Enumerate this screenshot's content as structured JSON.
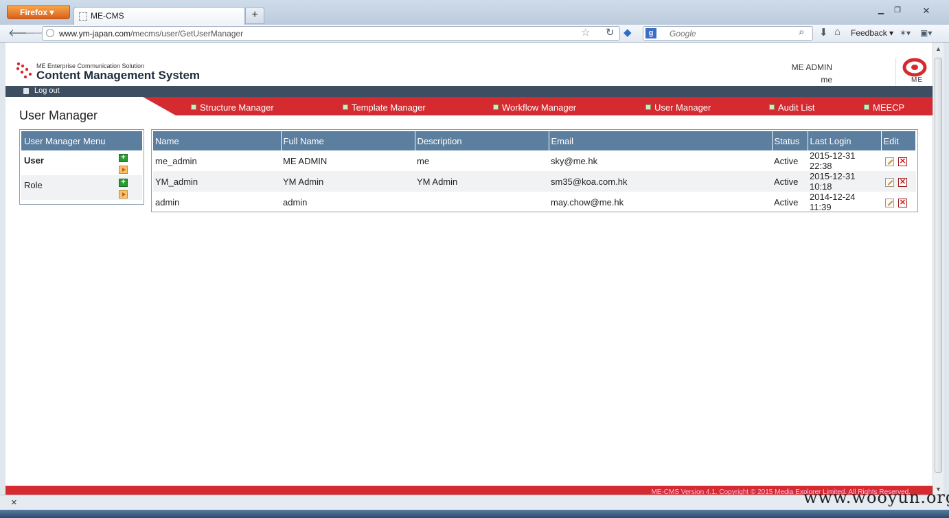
{
  "browser": {
    "app_button": "Firefox",
    "tab_title": "ME-CMS",
    "new_tab": "+",
    "url_host": "www.ym-japan.com",
    "url_path": "/mecms/user/GetUserManager",
    "search_placeholder": "Google",
    "feedback_label": "Feedback",
    "icons": [
      "back-arrow-icon",
      "forward-arrow-icon",
      "bookmark-star-icon",
      "reload-icon",
      "download-icon",
      "home-icon"
    ]
  },
  "header": {
    "subtitle": "ME Enterprise Communication Solution",
    "title": "Content Management System",
    "user_name": "ME ADMIN",
    "user_role": "me",
    "logo_text": "ME"
  },
  "toolbar": {
    "logout_label": "Log out"
  },
  "page_title": "User Manager",
  "nav": {
    "items": [
      {
        "label": "Structure Manager"
      },
      {
        "label": "Template Manager"
      },
      {
        "label": "Workflow Manager"
      },
      {
        "label": "User Manager"
      },
      {
        "label": "Audit List"
      },
      {
        "label": "MEECP"
      }
    ]
  },
  "left_menu": {
    "title": "User Manager Menu",
    "items": [
      {
        "label": "User"
      },
      {
        "label": "Role"
      }
    ]
  },
  "table": {
    "columns": [
      "Name",
      "Full Name",
      "Description",
      "Email",
      "Status",
      "Last Login",
      "Edit"
    ],
    "rows": [
      {
        "name": "me_admin",
        "full_name": "ME ADMIN",
        "description": "me",
        "email": "sky@me.hk",
        "status": "Active",
        "last_login": "2015-12-31 22:38"
      },
      {
        "name": "YM_admin",
        "full_name": "YM Admin",
        "description": "YM Admin",
        "email": "sm35@koa.com.hk",
        "status": "Active",
        "last_login": "2015-12-31 10:18"
      },
      {
        "name": "admin",
        "full_name": "admin",
        "description": "",
        "email": "may.chow@me.hk",
        "status": "Active",
        "last_login": "2014-12-24 11:39"
      }
    ]
  },
  "footer_text": "ME-CMS Version 4.1. Copyright © 2015 Media Explorer Limited. All Rights Reserved.",
  "addon_close": "×",
  "watermark": "www.wooyun.org",
  "colors": {
    "accent_red": "#d52b30",
    "header_blue": "#5d7f9f",
    "dark_bar": "#3d4e61"
  }
}
